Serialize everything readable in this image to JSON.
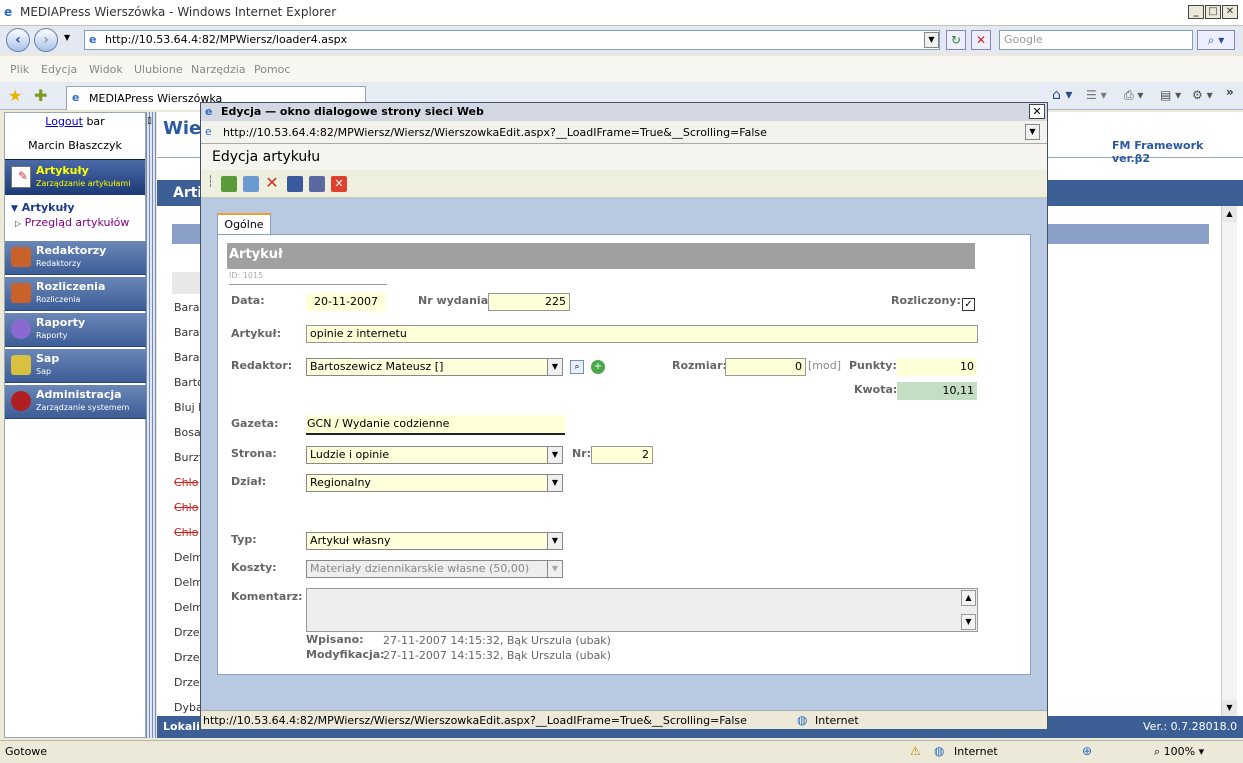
{
  "window": {
    "title": "MEDIAPress Wierszówka - Windows Internet Explorer"
  },
  "addressbar": {
    "url": "http://10.53.64.4:82/MPWiersz/loader4.aspx",
    "search_placeholder": "Google"
  },
  "menu": [
    "Plik",
    "Edycja",
    "Widok",
    "Ulubione",
    "Narzędzia",
    "Pomoc"
  ],
  "tab": {
    "label": "MEDIAPress Wierszówka"
  },
  "sidebar": {
    "logout": "Logout",
    "user_suffix": "bar",
    "username": "Marcin Błaszczyk",
    "active": {
      "label": "Artykuły",
      "sub": "Zarządzanie artykułami"
    },
    "tree_head": "Artykuły",
    "tree_item": "Przegląd artykułów",
    "items": [
      {
        "label": "Redaktorzy",
        "sub": "Redaktorzy"
      },
      {
        "label": "Rozliczenia",
        "sub": "Rozliczenia"
      },
      {
        "label": "Raporty",
        "sub": "Raporty"
      },
      {
        "label": "Sap",
        "sub": "Sap"
      },
      {
        "label": "Administracja",
        "sub": "Zarządzanie systemem"
      }
    ]
  },
  "bg": {
    "title": "Wie",
    "subbar": "Arti",
    "framework": "FM Framework ver.β2",
    "footer_left": "Lokali",
    "version": "Ver.: 0.7.28018.0",
    "rows": [
      "Bara",
      "Bara",
      "Bara",
      "Barto",
      "Bluj I",
      "Bosa",
      "Burzy",
      "Chlo",
      "Chlo",
      "Chlo",
      "Delm",
      "Delm",
      "Delm",
      "Drze",
      "Drze",
      "Drze",
      "Dyba"
    ]
  },
  "dialog": {
    "title": "Edycja — okno dialogowe strony sieci Web",
    "url": "http://10.53.64.4:82/MPWiersz/Wiersz/WierszowkaEdit.aspx?__LoadIFrame=True&__Scrolling=False",
    "heading": "Edycja artykułu",
    "tab": "Ogólne",
    "section": "Artykuł",
    "id_text": "ID: 1015",
    "fields": {
      "data_label": "Data:",
      "data_value": "20-11-2007",
      "nr_wydania_label": "Nr wydania:",
      "nr_wydania_value": "225",
      "rozliczony_label": "Rozliczony:",
      "artykul_label": "Artykuł:",
      "artykul_value": "opinie z internetu",
      "redaktor_label": "Redaktor:",
      "redaktor_value": "Bartoszewicz Mateusz []",
      "rozmiar_label": "Rozmiar:",
      "rozmiar_value": "0",
      "rozmiar_unit": "[mod]",
      "punkty_label": "Punkty:",
      "punkty_value": "10",
      "kwota_label": "Kwota:",
      "kwota_value": "10,11",
      "gazeta_label": "Gazeta:",
      "gazeta_value": "GCN / Wydanie codzienne",
      "strona_label": "Strona:",
      "strona_value": "Ludzie i opinie",
      "nr_label": "Nr:",
      "nr_value": "2",
      "dzial_label": "Dział:",
      "dzial_value": "Regionalny",
      "typ_label": "Typ:",
      "typ_value": "Artykuł własny",
      "koszty_label": "Koszty:",
      "koszty_value": "Materiały dziennikarskie własne (50,00)",
      "komentarz_label": "Komentarz:",
      "wpisano_label": "Wpisano:",
      "wpisano_value": "27-11-2007 14:15:32, Bąk Urszula (ubak)",
      "modyfikacja_label": "Modyfikacja:",
      "modyfikacja_value": "27-11-2007 14:15:32, Bąk Urszula (ubak)"
    },
    "status_url": "http://10.53.64.4:82/MPWiersz/Wiersz/WierszowkaEdit.aspx?__LoadIFrame=True&__Scrolling=False",
    "status_zone": "Internet"
  },
  "statusbar": {
    "left": "Gotowe",
    "zone": "Internet",
    "zoom": "100%"
  }
}
